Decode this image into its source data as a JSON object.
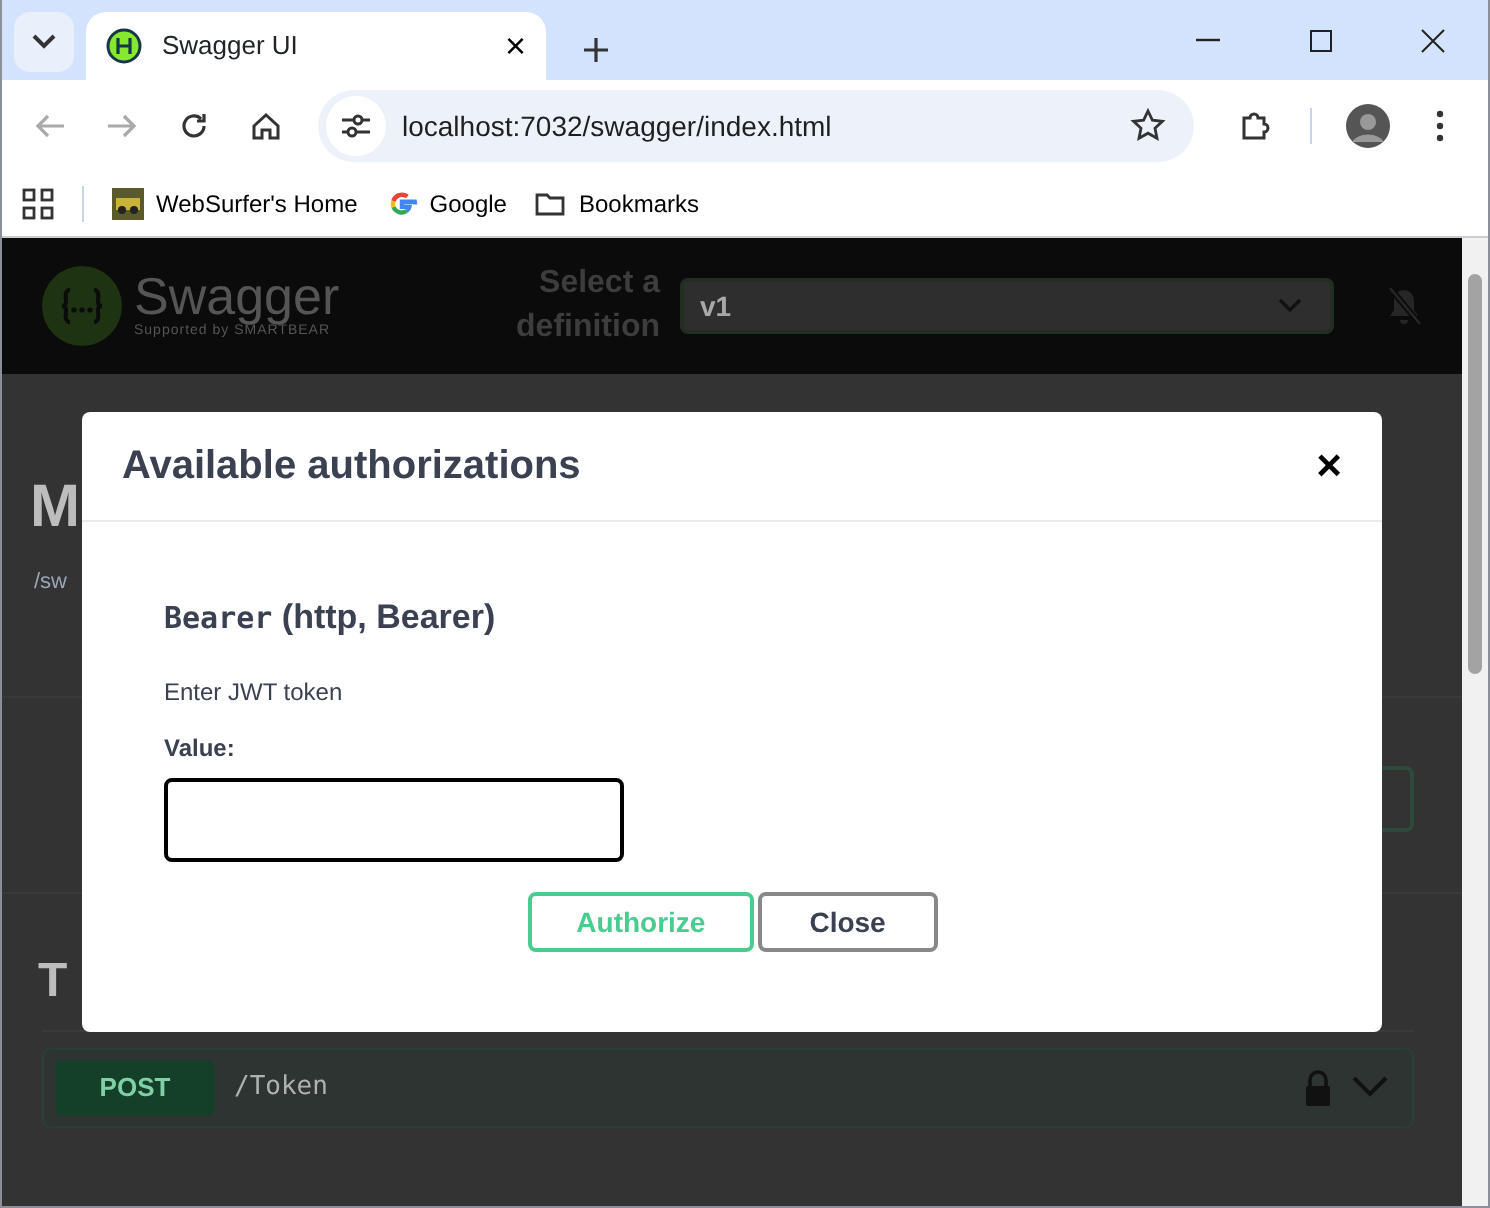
{
  "browser": {
    "tab": {
      "title": "Swagger UI",
      "close": "×"
    },
    "address": "localhost:7032/swagger/index.html",
    "bookmarks": [
      {
        "label": "WebSurfer's Home",
        "kind": "site"
      },
      {
        "label": "Google",
        "kind": "google"
      },
      {
        "label": "Bookmarks",
        "kind": "folder"
      }
    ]
  },
  "header": {
    "logo": "Swagger",
    "logo_sub": "Supported by SMARTBEAR",
    "definition_label": "Select a definition",
    "definition": "v1"
  },
  "page": {
    "title": "M",
    "link": "/sw",
    "section": "T",
    "operations": [
      {
        "method": "POST",
        "path": "/Token"
      }
    ]
  },
  "dialog": {
    "title": "Available authorizations",
    "close": "×",
    "scheme": {
      "name": "Bearer",
      "type": "(http, Bearer)",
      "description": "Enter JWT token",
      "value_label": "Value:"
    },
    "buttons": [
      {
        "label": "Authorize",
        "kind": "primary"
      },
      {
        "label": "Close",
        "kind": "secondary"
      }
    ]
  }
}
